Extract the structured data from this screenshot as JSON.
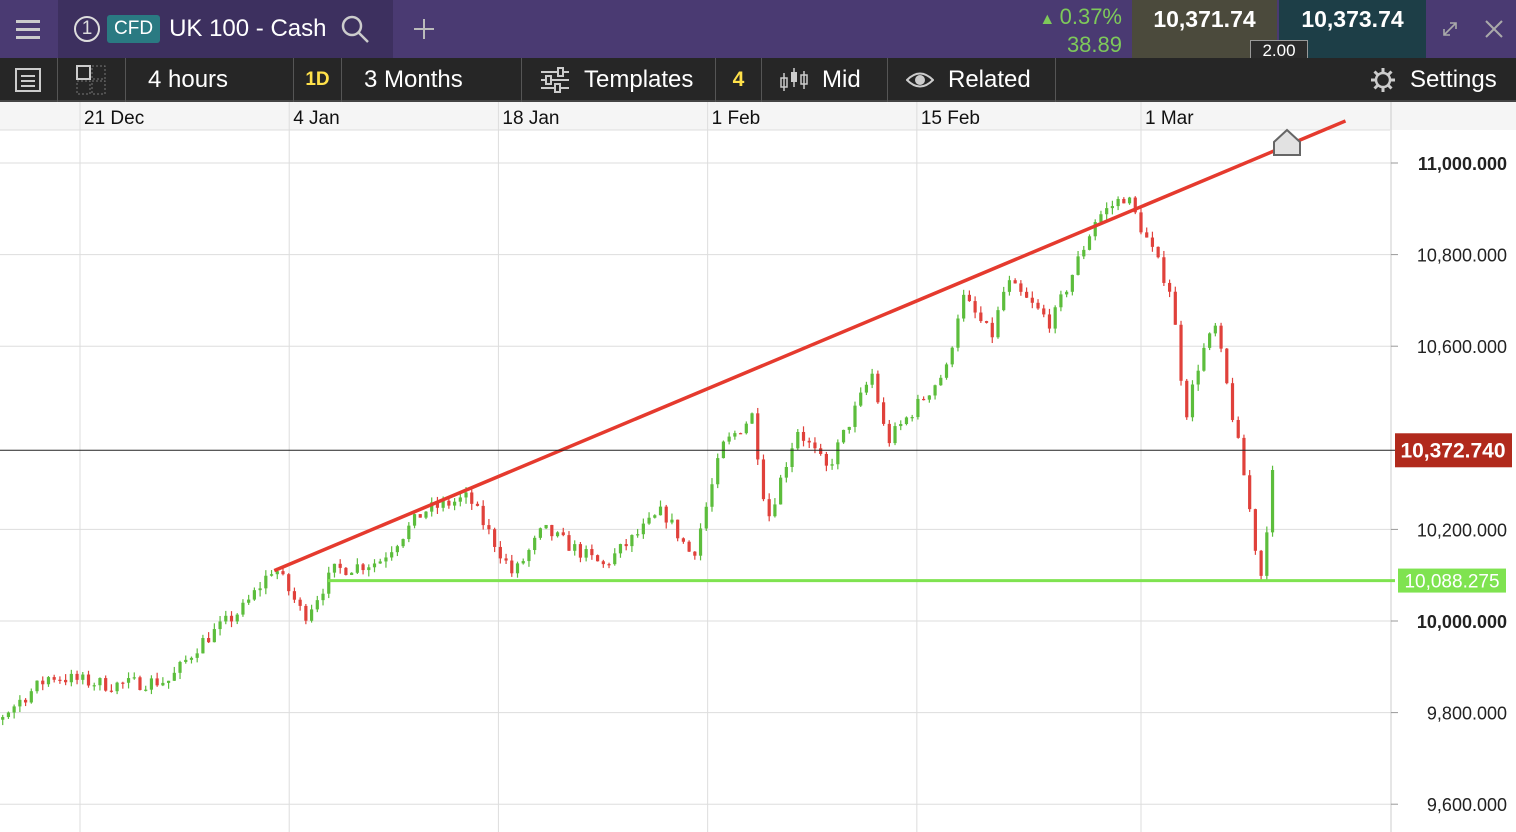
{
  "header": {
    "tab_number": "1",
    "badge": "CFD",
    "instrument": "UK 100 - Cash",
    "change_pct": "0.37%",
    "change_abs": "38.89",
    "sell_price": "10,371.74",
    "buy_price": "10,373.74",
    "spread": "2.00",
    "icons": [
      "menu-icon",
      "search-icon",
      "plus-icon",
      "expand-icon",
      "close-icon"
    ]
  },
  "toolbar": {
    "interval": "4 hours",
    "day_badge": "1D",
    "range": "3 Months",
    "templates_label": "Templates",
    "count_badge": "4",
    "price_type": "Mid",
    "related_label": "Related",
    "settings_label": "Settings"
  },
  "colors": {
    "up": "#5cbd3c",
    "down": "#e0413b",
    "trendline": "#e53a2e",
    "support": "#7fe350",
    "current": "#b12a1c",
    "purple": "#4a3a72"
  },
  "chart_data": {
    "type": "candlestick",
    "x_labels": [
      "21 Dec",
      "4 Jan",
      "18 Jan",
      "1 Feb",
      "15 Feb",
      "1 Mar"
    ],
    "y_ticks": [
      "11,000.000",
      "10,800.000",
      "10,600.000",
      "10,200.000",
      "10,000.000",
      "9,800.000",
      "9,600.000"
    ],
    "ylim": [
      9570,
      11070
    ],
    "current_price_label": "10,372.740",
    "current_price": 10372.74,
    "support_label": "10,088.275",
    "support_price": 10088.275,
    "trendline": {
      "start_date": "3 Jan",
      "start_price": 10110,
      "end_date": "10 Mar",
      "end_price": 11070
    },
    "path_points": [
      [
        "12 Dec",
        9670
      ],
      [
        "16 Dec",
        9800
      ],
      [
        "19 Dec",
        9880
      ],
      [
        "23 Dec",
        9860
      ],
      [
        "27 Dec",
        9870
      ],
      [
        "29 Dec",
        9950
      ],
      [
        "1 Jan",
        10030
      ],
      [
        "3 Jan",
        10120
      ],
      [
        "5 Jan",
        10010
      ],
      [
        "7 Jan",
        10110
      ],
      [
        "10 Jan",
        10130
      ],
      [
        "13 Jan",
        10240
      ],
      [
        "16 Jan",
        10270
      ],
      [
        "19 Jan",
        10100
      ],
      [
        "21 Jan",
        10200
      ],
      [
        "25 Jan",
        10120
      ],
      [
        "29 Jan",
        10240
      ],
      [
        "31 Jan",
        10140
      ],
      [
        "2 Feb",
        10380
      ],
      [
        "4 Feb",
        10450
      ],
      [
        "5 Feb",
        10220
      ],
      [
        "7 Feb",
        10420
      ],
      [
        "9 Feb",
        10330
      ],
      [
        "12 Feb",
        10540
      ],
      [
        "13 Feb",
        10390
      ],
      [
        "17 Feb",
        10550
      ],
      [
        "18 Feb",
        10710
      ],
      [
        "20 Feb",
        10620
      ],
      [
        "21 Feb",
        10740
      ],
      [
        "24 Feb",
        10650
      ],
      [
        "27 Feb",
        10880
      ],
      [
        "29 Feb",
        10930
      ],
      [
        "1 Mar",
        10860
      ],
      [
        "3 Mar",
        10720
      ],
      [
        "4 Mar",
        10450
      ],
      [
        "5 Mar",
        10580
      ],
      [
        "6 Mar",
        10640
      ],
      [
        "8 Mar",
        10300
      ],
      [
        "9 Mar",
        10090
      ],
      [
        "10 Mar",
        10373
      ]
    ]
  }
}
